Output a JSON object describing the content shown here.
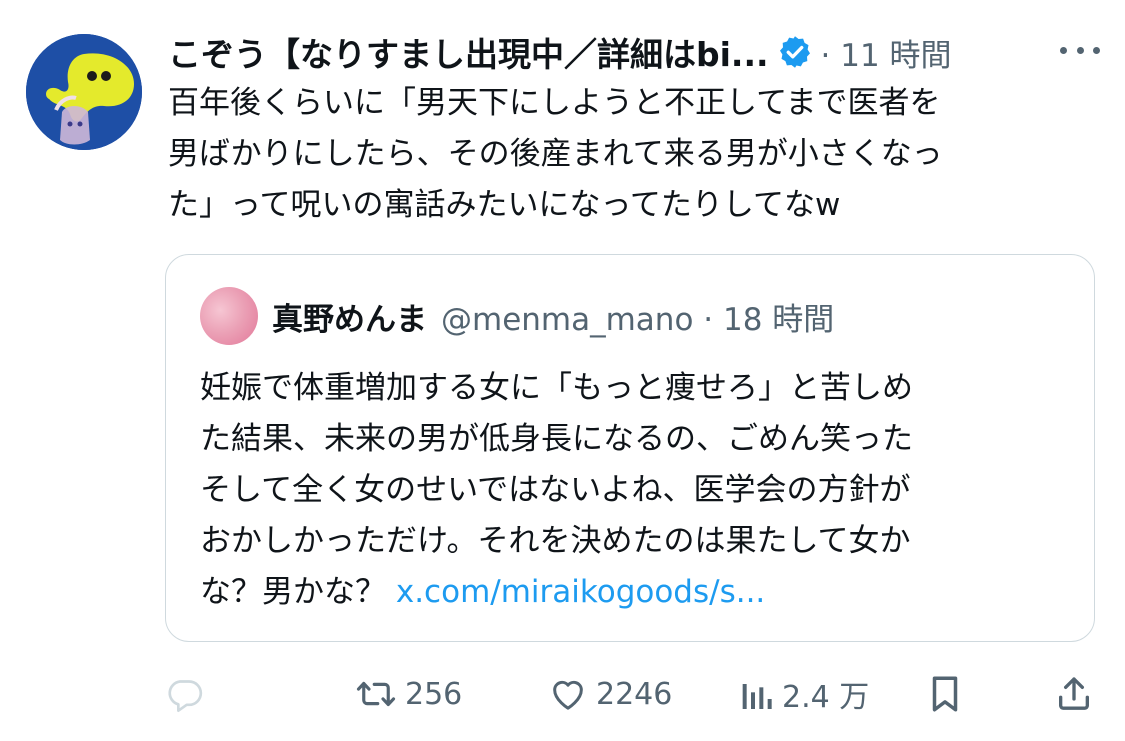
{
  "post": {
    "author": {
      "display_name": "こぞう【なりすまし出現中／詳細はbi...",
      "avatar_icon": "octopus-avatar-icon"
    },
    "meta": "· 11 時間",
    "text_lines": [
      "百年後くらいに「男天下にしようと不正してまで医者を",
      "男ばかりにしたら、その後産まれて来る男が小さくなっ",
      "た」って呪いの寓話みたいになってたりしてなw"
    ]
  },
  "quote": {
    "display_name": "真野めんま",
    "meta": "@menma_mano · 18 時間",
    "text_lines": [
      "妊娠で体重増加する女に「もっと痩せろ」と苦しめ",
      "た結果、未来の男が低身長になるの、ごめん笑った",
      "そして全く女のせいではないよね、医学会の方針が",
      "おかしかっただけ。それを決めたのは果たして女か"
    ],
    "last_line_text": "な？男かな？",
    "link": "x.com/miraikogoods/s..."
  },
  "actions": {
    "reply_count": "",
    "repost_count": "256",
    "like_count": "2246",
    "views_count": "2.4 万"
  },
  "colors": {
    "accent": "#1d9bf0",
    "muted": "#536471",
    "text": "#0f1419",
    "border": "#cfd9de",
    "verified": "#1d9bf0"
  }
}
